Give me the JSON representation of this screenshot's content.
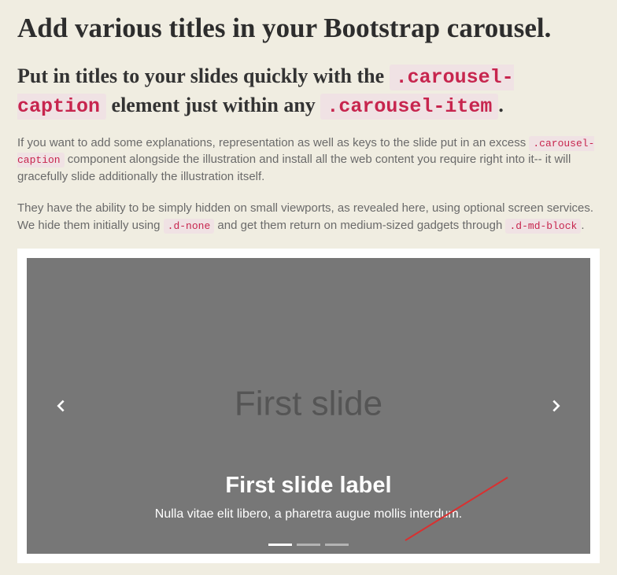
{
  "heading": "Add various titles in your Bootstrap carousel.",
  "subheading": {
    "part1": "Put in titles to your slides quickly with the ",
    "code1": ".carousel-caption",
    "part2": " element just within any ",
    "code2": ".carousel-item",
    "part3": "."
  },
  "para1": {
    "t1": "If you want to add some explanations, representation as well as keys to the slide put in an excess ",
    "c1": ".carousel-caption",
    "t2": " component alongside the illustration and install all the web content you require right into it-- it will gracefully slide additionally the illustration itself."
  },
  "para2": {
    "t1": "They have the ability to be simply hidden on small viewports, as revealed here, using optional screen services. We hide them initially using ",
    "c1": ".d-none",
    "t2": " and get them return on medium-sized gadgets through ",
    "c2": ".d-md-block",
    "t3": "."
  },
  "carousel": {
    "slide_placeholder": "First slide",
    "caption_title": "First slide label",
    "caption_text": "Nulla vitae elit libero, a pharetra augue mollis interdum."
  }
}
